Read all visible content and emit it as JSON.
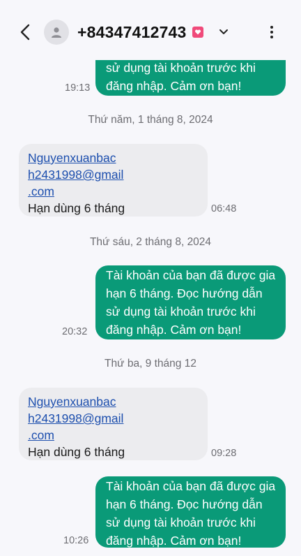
{
  "header": {
    "contact": "+84347412743",
    "icons": {
      "back": "back-arrow-icon",
      "avatar": "person-icon",
      "badge": "heart-badge-icon",
      "expand": "chevron-down-icon",
      "more": "more-vert-icon"
    }
  },
  "messages": [
    {
      "type": "sent",
      "lines": [
        "sử dụng tài khoản trước khi",
        "đăng nhập. Cảm ơn bạn!"
      ],
      "time": "19:13"
    },
    {
      "type": "date",
      "label": "Thứ năm, 1 tháng 8, 2024"
    },
    {
      "type": "received",
      "link_lines": [
        "Nguyenxuanbac",
        "h2431998@gmail",
        ".com"
      ],
      "text": "Hạn dùng 6 tháng",
      "time": "06:48"
    },
    {
      "type": "date",
      "label": "Thứ sáu, 2 tháng 8, 2024"
    },
    {
      "type": "sent",
      "lines": [
        "Tài khoản của bạn đã được gia",
        "hạn 6 tháng. Đọc hướng dẫn",
        "sử dụng tài khoản trước khi",
        "đăng nhập. Cảm ơn bạn!"
      ],
      "time": "20:32"
    },
    {
      "type": "date",
      "label": "Thứ ba, 9 tháng 12"
    },
    {
      "type": "received",
      "link_lines": [
        "Nguyenxuanbac",
        "h2431998@gmail",
        ".com"
      ],
      "text": "Hạn dùng 6 tháng",
      "time": "09:28"
    },
    {
      "type": "sent",
      "lines": [
        "Tài khoản của bạn đã được gia",
        "hạn 6 tháng. Đọc hướng dẫn",
        "sử dụng tài khoản trước khi",
        "đăng nhập. Cảm ơn bạn!"
      ],
      "time": "10:26"
    }
  ],
  "colors": {
    "sent_bubble": "#0a9a78",
    "received_bubble": "#ececef",
    "link": "#1d4fae",
    "badge": "#f04a7a"
  }
}
